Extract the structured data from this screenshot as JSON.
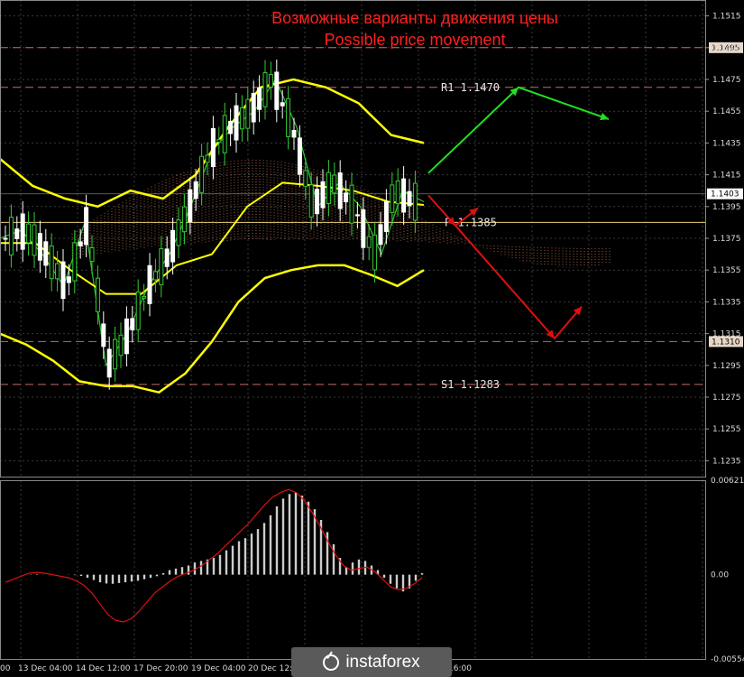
{
  "title_ru": "Возможные варианты движения цены",
  "title_en": "Possible price movement",
  "colors": {
    "background": "#000000",
    "grid": "#3a3a3a",
    "axis_text": "#d9d9d9",
    "title": "#ff2020",
    "bollinger": "#ffff00",
    "green_line": "#2ec42e",
    "red_line": "#e01010",
    "blue_line": "#2233ff",
    "cloud": "#ff9a70",
    "level_dash": "#c86a6a",
    "bull_arrow": "#20e020",
    "bear_arrow": "#e01010",
    "histogram": "#cccccc",
    "signal": "#e01010",
    "candle_bull": "#33cc33",
    "candle_bear": "#ffffff"
  },
  "levels": [
    {
      "name": "",
      "value": 1.1495,
      "label": "1.1495"
    },
    {
      "name": "R1",
      "value": 1.147,
      "label": "1.1470"
    },
    {
      "name": "P",
      "value": 1.1385,
      "label": "1.1385"
    },
    {
      "name": "",
      "value": 1.131,
      "label": "1.1310"
    },
    {
      "name": "S1",
      "value": 1.1283,
      "label": "1.1283"
    }
  ],
  "current_price": "1.1403",
  "chart_data": [
    {
      "type": "line",
      "title": "Возможные варианты движения цены / Possible price movement",
      "price_axis": {
        "ylim": [
          1.1225,
          1.1525
        ],
        "ticks": [
          "1.1515",
          "1.1495",
          "1.1475",
          "1.1455",
          "1.1435",
          "1.1415",
          "1.1395",
          "1.1375",
          "1.1355",
          "1.1335",
          "1.1315",
          "1.1295",
          "1.1275",
          "1.1255",
          "1.1235"
        ]
      },
      "time_axis": {
        "ticks": [
          "00",
          "13 Dec 04:00",
          "14 Dec 12:00",
          "17 Dec 20:00",
          "19 Dec 04:00",
          "20 Dec 12:00",
          "16:00"
        ]
      },
      "series": [
        {
          "name": "",
          "values": [
            1.1375,
            1.138,
            1.1365,
            1.1345,
            1.1385,
            1.1295,
            1.1315,
            1.1345,
            1.1365,
            1.1395,
            1.143,
            1.1445,
            1.1455,
            1.1475,
            1.1445,
            1.1395,
            1.141,
            1.1395,
            1.1365,
            1.1405,
            1.1398
          ]
        },
        {
          "name": "",
          "values": [
            1.1315,
            1.1308,
            1.1298,
            1.1285,
            1.1282,
            1.1282,
            1.1278,
            1.129,
            1.131,
            1.1335,
            1.135,
            1.1355,
            1.1358,
            1.1358,
            1.1352,
            1.1345,
            1.1355
          ]
        },
        {
          "name": "",
          "values": [
            1.1425,
            1.1408,
            1.14,
            1.1395,
            1.1405,
            1.14,
            1.1415,
            1.1445,
            1.147,
            1.1475,
            1.147,
            1.146,
            1.144,
            1.1435
          ]
        },
        {
          "name": "",
          "values": [
            1.1372,
            1.1372,
            1.1355,
            1.134,
            1.134,
            1.1358,
            1.1365,
            1.1395,
            1.141,
            1.1408,
            1.1405,
            1.1398,
            1.1396
          ]
        }
      ],
      "projection": [
        {
          "direction": "up",
          "points": [
            [
              0,
              1.1416
            ],
            [
              1,
              1.147
            ],
            [
              2,
              1.145
            ]
          ]
        },
        {
          "direction": "down",
          "points": [
            [
              0,
              1.1402
            ],
            [
              0.3,
              1.1383
            ],
            [
              0.55,
              1.1394
            ]
          ]
        },
        {
          "direction": "down",
          "points": [
            [
              0.3,
              1.1383
            ],
            [
              1.4,
              1.1312
            ],
            [
              1.7,
              1.1332
            ]
          ]
        }
      ]
    },
    {
      "type": "bar",
      "title": "",
      "ylim": [
        -0.00554,
        0.00621
      ],
      "ticks": [
        "0.00621",
        "0.00",
        "-0.00554"
      ],
      "values": [
        0,
        0,
        0,
        0,
        2e-05,
        3e-05,
        1e-05,
        0,
        -1e-05,
        0,
        -1e-05,
        -3e-05,
        -8e-05,
        -0.0002,
        -0.00035,
        -0.0005,
        -0.00058,
        -0.0006,
        -0.00055,
        -0.0005,
        -0.00045,
        -0.0004,
        -0.0003,
        -0.0002,
        -0.0001,
        0.0001,
        0.0003,
        0.0004,
        0.0005,
        0.0006,
        0.0008,
        0.0009,
        0.001,
        0.0011,
        0.0013,
        0.0016,
        0.0019,
        0.0022,
        0.0024,
        0.0027,
        0.003,
        0.0034,
        0.0039,
        0.0045,
        0.005,
        0.0053,
        0.0054,
        0.0052,
        0.0048,
        0.0043,
        0.0036,
        0.0028,
        0.002,
        0.0011,
        0.0005,
        0.0008,
        0.001,
        0.0009,
        0.0006,
        0.0003,
        -0.0002,
        -0.0006,
        -0.0009,
        -0.0011,
        -0.0009,
        -0.0004,
        0.0001
      ],
      "signal": [
        -0.0005,
        -0.0003,
        -0.0001,
        0.0001,
        0.00015,
        0.0001,
        0,
        -0.0001,
        -0.0002,
        -0.0004,
        -0.0007,
        -0.0012,
        -0.0019,
        -0.0026,
        -0.003,
        -0.0031,
        -0.0029,
        -0.0024,
        -0.0018,
        -0.0012,
        -0.0008,
        -0.0004,
        -0.0001,
        0.0001,
        0.0003,
        0.0006,
        0.001,
        0.0014,
        0.0019,
        0.0024,
        0.0029,
        0.0034,
        0.004,
        0.0046,
        0.0051,
        0.0054,
        0.0056,
        0.0054,
        0.0049,
        0.0041,
        0.0032,
        0.0022,
        0.0013,
        0.0006,
        0.0003,
        0.0004,
        0.0005,
        0.0002,
        -0.0003,
        -0.0008,
        -0.001,
        -0.0009,
        -0.0006,
        -0.0002
      ]
    }
  ],
  "logo_text": "instaforex"
}
